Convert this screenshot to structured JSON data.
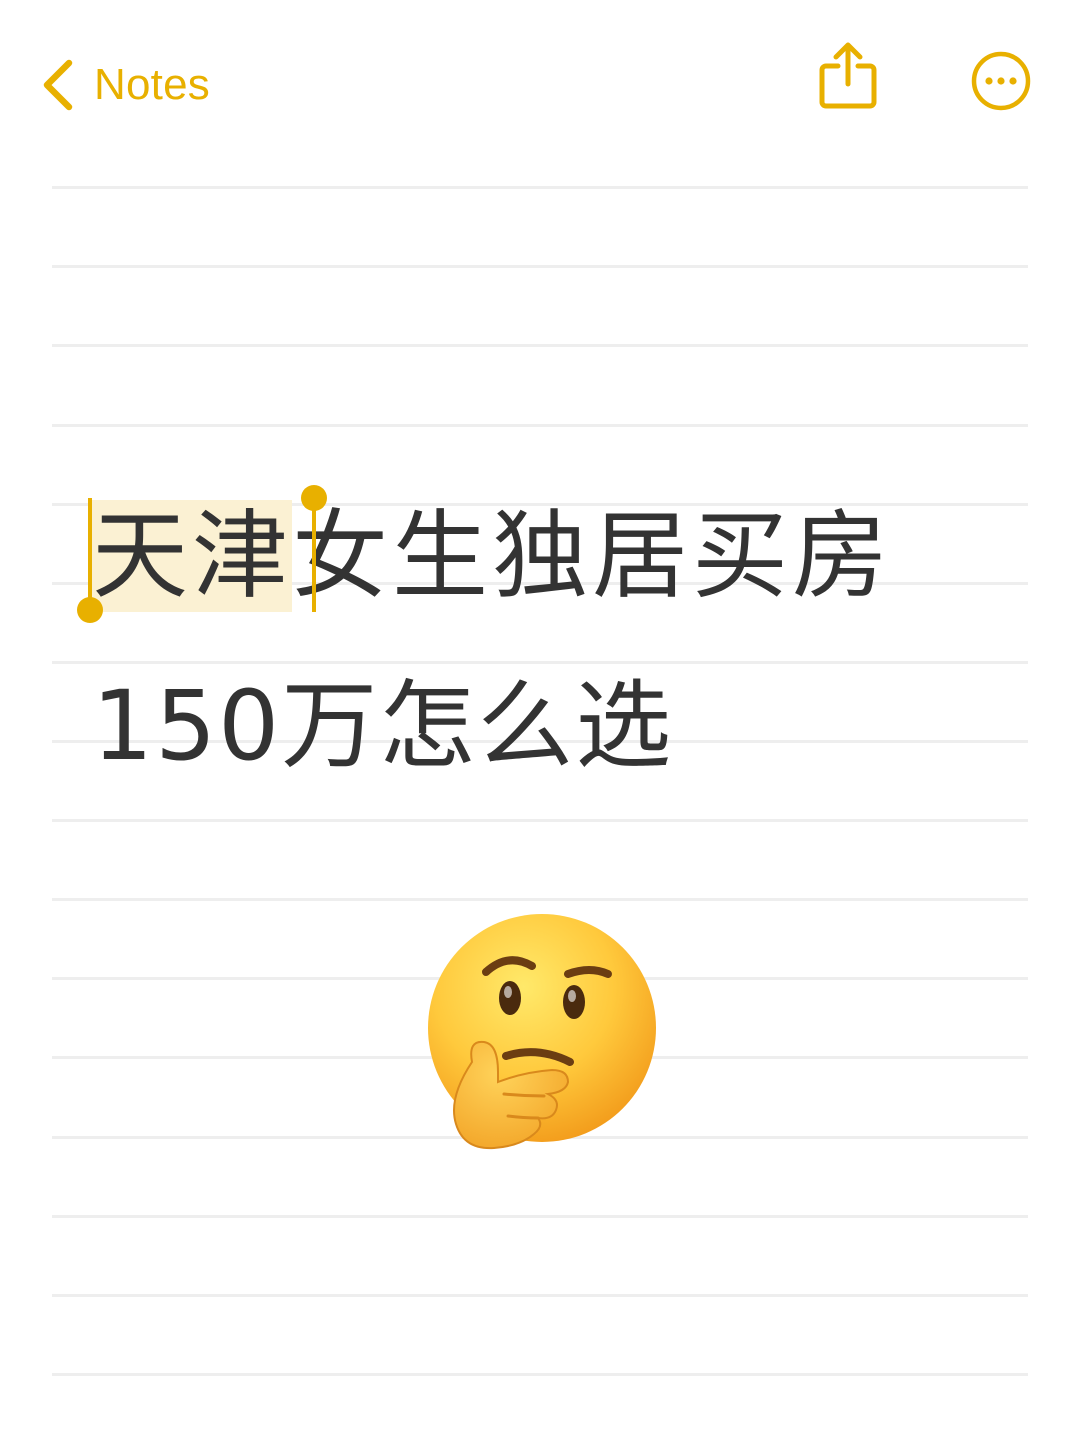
{
  "app": {
    "accent_color": "#E8B000"
  },
  "nav": {
    "back_label": "Notes",
    "back_icon": "chevron-left-icon",
    "share_icon": "share-icon",
    "more_icon": "ellipsis-circle-icon"
  },
  "note": {
    "title_line_1_selected": "天津",
    "title_line_1_rest": "女生独居买房",
    "title_line_2": "150万怎么选",
    "emoji": "thinking-face-icon"
  }
}
